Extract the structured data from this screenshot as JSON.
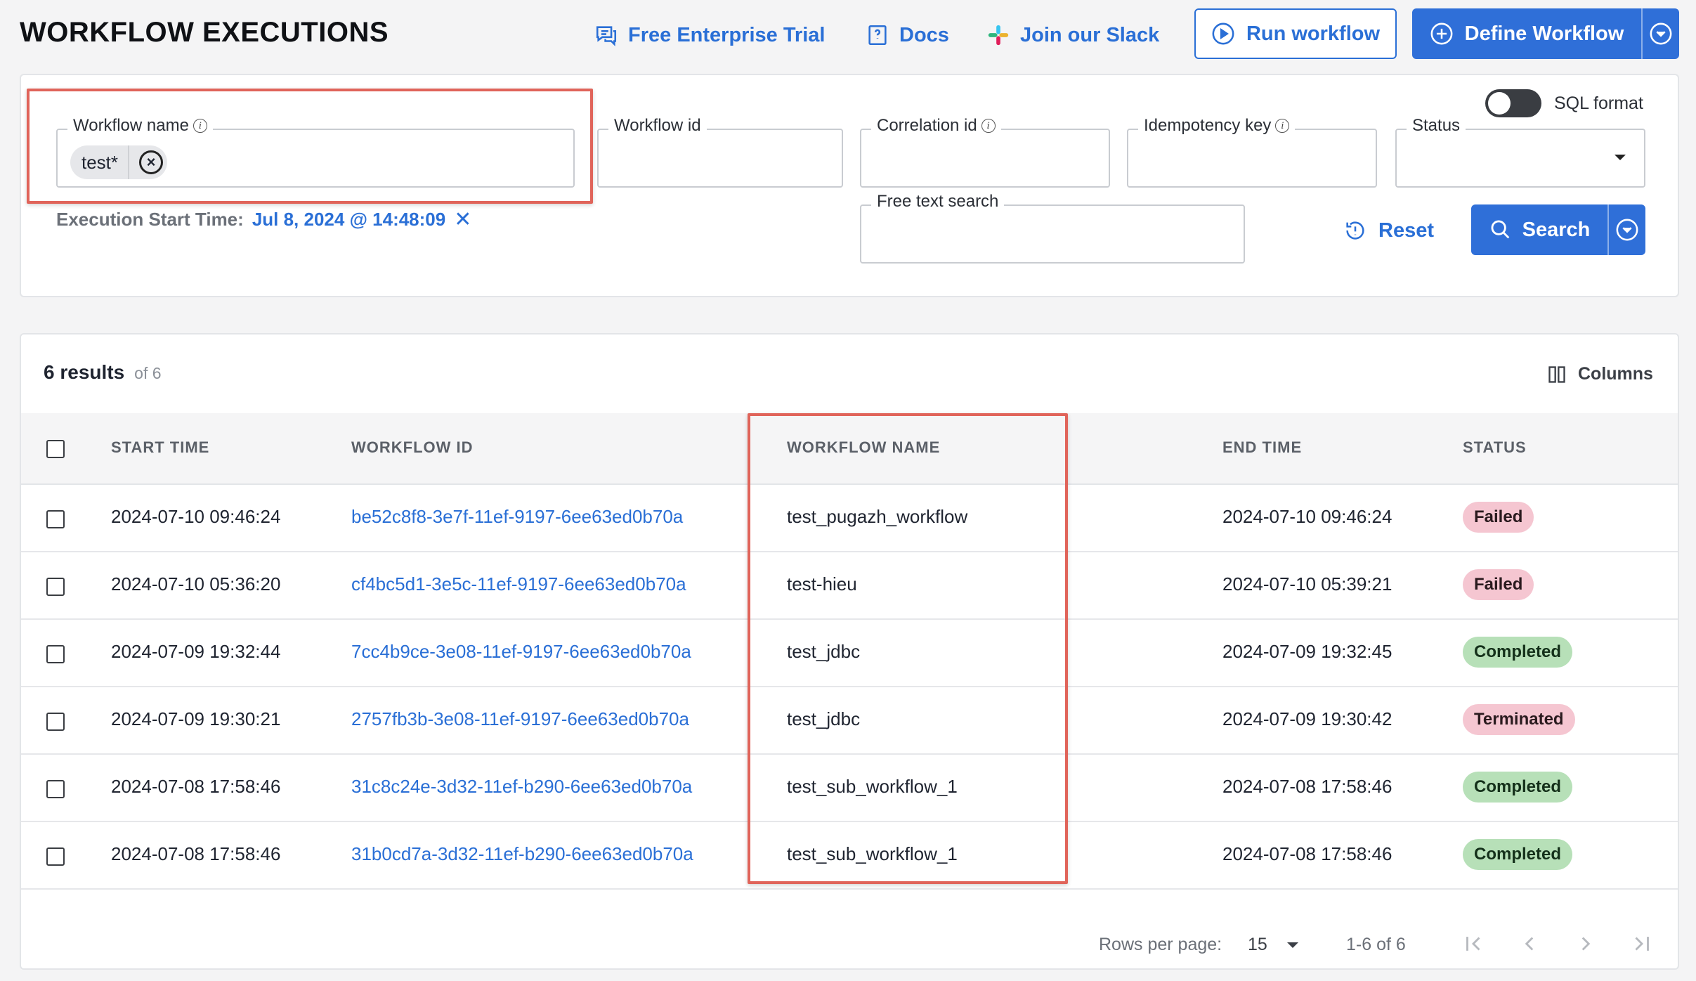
{
  "header": {
    "title": "WORKFLOW EXECUTIONS",
    "links": {
      "trial": "Free Enterprise Trial",
      "docs": "Docs",
      "slack": "Join our Slack"
    },
    "run_workflow": "Run workflow",
    "define_workflow": "Define Workflow"
  },
  "filters": {
    "workflow_name": {
      "label": "Workflow name",
      "chip": "test*"
    },
    "workflow_id": {
      "label": "Workflow id",
      "value": ""
    },
    "correlation_id": {
      "label": "Correlation id",
      "value": ""
    },
    "idempotency_key": {
      "label": "Idempotency key",
      "value": ""
    },
    "status": {
      "label": "Status",
      "value": ""
    },
    "free_text": {
      "label": "Free text search",
      "value": ""
    },
    "sql_format_label": "SQL format",
    "sql_format_on": false,
    "start_time_label": "Execution Start Time:",
    "start_time_value": "Jul 8, 2024 @ 14:48:09",
    "reset": "Reset",
    "search": "Search"
  },
  "results": {
    "count": "6 results",
    "of": "of 6",
    "columns": "Columns",
    "headers": {
      "start_time": "START TIME",
      "workflow_id": "WORKFLOW ID",
      "workflow_name": "WORKFLOW NAME",
      "end_time": "END TIME",
      "status": "STATUS"
    },
    "rows": [
      {
        "start": "2024-07-10 09:46:24",
        "id": "be52c8f8-3e7f-11ef-9197-6ee63ed0b70a",
        "name": "test_pugazh_workflow",
        "end": "2024-07-10 09:46:24",
        "status": "Failed"
      },
      {
        "start": "2024-07-10 05:36:20",
        "id": "cf4bc5d1-3e5c-11ef-9197-6ee63ed0b70a",
        "name": "test-hieu",
        "end": "2024-07-10 05:39:21",
        "status": "Failed"
      },
      {
        "start": "2024-07-09 19:32:44",
        "id": "7cc4b9ce-3e08-11ef-9197-6ee63ed0b70a",
        "name": "test_jdbc",
        "end": "2024-07-09 19:32:45",
        "status": "Completed"
      },
      {
        "start": "2024-07-09 19:30:21",
        "id": "2757fb3b-3e08-11ef-9197-6ee63ed0b70a",
        "name": "test_jdbc",
        "end": "2024-07-09 19:30:42",
        "status": "Terminated"
      },
      {
        "start": "2024-07-08 17:58:46",
        "id": "31c8c24e-3d32-11ef-b290-6ee63ed0b70a",
        "name": "test_sub_workflow_1",
        "end": "2024-07-08 17:58:46",
        "status": "Completed"
      },
      {
        "start": "2024-07-08 17:58:46",
        "id": "31b0cd7a-3d32-11ef-b290-6ee63ed0b70a",
        "name": "test_sub_workflow_1",
        "end": "2024-07-08 17:58:46",
        "status": "Completed"
      }
    ],
    "footer": {
      "rows_per_page_label": "Rows per page:",
      "rows_per_page": "15",
      "range": "1-6 of 6"
    }
  },
  "colors": {
    "accent": "#2f6fd8",
    "highlight": "#e0645a",
    "failed_bg": "#f5c6d1",
    "completed_bg": "#b7e0b8"
  },
  "icons": [
    "chat-icon",
    "docs-icon",
    "slack-icon",
    "play-circle-icon",
    "plus-circle-icon",
    "chevron-down-circle-icon",
    "info-icon",
    "clear-chip-icon",
    "caret-down-icon",
    "close-icon",
    "reset-icon",
    "search-icon",
    "columns-icon",
    "first-page-icon",
    "prev-page-icon",
    "next-page-icon",
    "last-page-icon"
  ]
}
